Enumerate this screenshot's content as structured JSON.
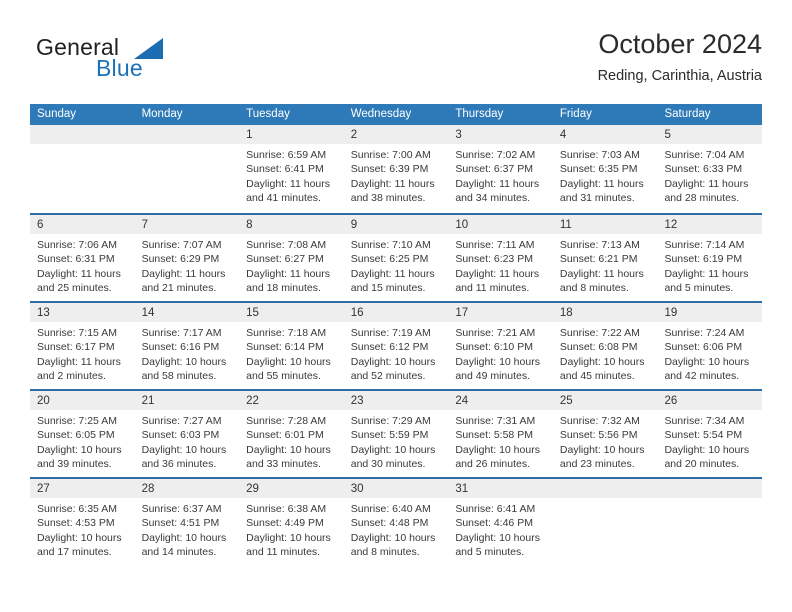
{
  "brand": {
    "name_part1": "General",
    "name_part2": "Blue",
    "accent_color": "#1b6cb0"
  },
  "header": {
    "title": "October 2024",
    "subtitle": "Reding, Carinthia, Austria"
  },
  "calendar": {
    "header_color": "#2e7ab8",
    "separator_color": "#2e6da4",
    "daynum_band_color": "#eeeeee",
    "weekdays": [
      "Sunday",
      "Monday",
      "Tuesday",
      "Wednesday",
      "Thursday",
      "Friday",
      "Saturday"
    ],
    "weeks": [
      [
        {
          "day": "",
          "sunrise": "",
          "sunset": "",
          "daylight_line1": "",
          "daylight_line2": ""
        },
        {
          "day": "",
          "sunrise": "",
          "sunset": "",
          "daylight_line1": "",
          "daylight_line2": ""
        },
        {
          "day": "1",
          "sunrise": "Sunrise: 6:59 AM",
          "sunset": "Sunset: 6:41 PM",
          "daylight_line1": "Daylight: 11 hours",
          "daylight_line2": "and 41 minutes."
        },
        {
          "day": "2",
          "sunrise": "Sunrise: 7:00 AM",
          "sunset": "Sunset: 6:39 PM",
          "daylight_line1": "Daylight: 11 hours",
          "daylight_line2": "and 38 minutes."
        },
        {
          "day": "3",
          "sunrise": "Sunrise: 7:02 AM",
          "sunset": "Sunset: 6:37 PM",
          "daylight_line1": "Daylight: 11 hours",
          "daylight_line2": "and 34 minutes."
        },
        {
          "day": "4",
          "sunrise": "Sunrise: 7:03 AM",
          "sunset": "Sunset: 6:35 PM",
          "daylight_line1": "Daylight: 11 hours",
          "daylight_line2": "and 31 minutes."
        },
        {
          "day": "5",
          "sunrise": "Sunrise: 7:04 AM",
          "sunset": "Sunset: 6:33 PM",
          "daylight_line1": "Daylight: 11 hours",
          "daylight_line2": "and 28 minutes."
        }
      ],
      [
        {
          "day": "6",
          "sunrise": "Sunrise: 7:06 AM",
          "sunset": "Sunset: 6:31 PM",
          "daylight_line1": "Daylight: 11 hours",
          "daylight_line2": "and 25 minutes."
        },
        {
          "day": "7",
          "sunrise": "Sunrise: 7:07 AM",
          "sunset": "Sunset: 6:29 PM",
          "daylight_line1": "Daylight: 11 hours",
          "daylight_line2": "and 21 minutes."
        },
        {
          "day": "8",
          "sunrise": "Sunrise: 7:08 AM",
          "sunset": "Sunset: 6:27 PM",
          "daylight_line1": "Daylight: 11 hours",
          "daylight_line2": "and 18 minutes."
        },
        {
          "day": "9",
          "sunrise": "Sunrise: 7:10 AM",
          "sunset": "Sunset: 6:25 PM",
          "daylight_line1": "Daylight: 11 hours",
          "daylight_line2": "and 15 minutes."
        },
        {
          "day": "10",
          "sunrise": "Sunrise: 7:11 AM",
          "sunset": "Sunset: 6:23 PM",
          "daylight_line1": "Daylight: 11 hours",
          "daylight_line2": "and 11 minutes."
        },
        {
          "day": "11",
          "sunrise": "Sunrise: 7:13 AM",
          "sunset": "Sunset: 6:21 PM",
          "daylight_line1": "Daylight: 11 hours",
          "daylight_line2": "and 8 minutes."
        },
        {
          "day": "12",
          "sunrise": "Sunrise: 7:14 AM",
          "sunset": "Sunset: 6:19 PM",
          "daylight_line1": "Daylight: 11 hours",
          "daylight_line2": "and 5 minutes."
        }
      ],
      [
        {
          "day": "13",
          "sunrise": "Sunrise: 7:15 AM",
          "sunset": "Sunset: 6:17 PM",
          "daylight_line1": "Daylight: 11 hours",
          "daylight_line2": "and 2 minutes."
        },
        {
          "day": "14",
          "sunrise": "Sunrise: 7:17 AM",
          "sunset": "Sunset: 6:16 PM",
          "daylight_line1": "Daylight: 10 hours",
          "daylight_line2": "and 58 minutes."
        },
        {
          "day": "15",
          "sunrise": "Sunrise: 7:18 AM",
          "sunset": "Sunset: 6:14 PM",
          "daylight_line1": "Daylight: 10 hours",
          "daylight_line2": "and 55 minutes."
        },
        {
          "day": "16",
          "sunrise": "Sunrise: 7:19 AM",
          "sunset": "Sunset: 6:12 PM",
          "daylight_line1": "Daylight: 10 hours",
          "daylight_line2": "and 52 minutes."
        },
        {
          "day": "17",
          "sunrise": "Sunrise: 7:21 AM",
          "sunset": "Sunset: 6:10 PM",
          "daylight_line1": "Daylight: 10 hours",
          "daylight_line2": "and 49 minutes."
        },
        {
          "day": "18",
          "sunrise": "Sunrise: 7:22 AM",
          "sunset": "Sunset: 6:08 PM",
          "daylight_line1": "Daylight: 10 hours",
          "daylight_line2": "and 45 minutes."
        },
        {
          "day": "19",
          "sunrise": "Sunrise: 7:24 AM",
          "sunset": "Sunset: 6:06 PM",
          "daylight_line1": "Daylight: 10 hours",
          "daylight_line2": "and 42 minutes."
        }
      ],
      [
        {
          "day": "20",
          "sunrise": "Sunrise: 7:25 AM",
          "sunset": "Sunset: 6:05 PM",
          "daylight_line1": "Daylight: 10 hours",
          "daylight_line2": "and 39 minutes."
        },
        {
          "day": "21",
          "sunrise": "Sunrise: 7:27 AM",
          "sunset": "Sunset: 6:03 PM",
          "daylight_line1": "Daylight: 10 hours",
          "daylight_line2": "and 36 minutes."
        },
        {
          "day": "22",
          "sunrise": "Sunrise: 7:28 AM",
          "sunset": "Sunset: 6:01 PM",
          "daylight_line1": "Daylight: 10 hours",
          "daylight_line2": "and 33 minutes."
        },
        {
          "day": "23",
          "sunrise": "Sunrise: 7:29 AM",
          "sunset": "Sunset: 5:59 PM",
          "daylight_line1": "Daylight: 10 hours",
          "daylight_line2": "and 30 minutes."
        },
        {
          "day": "24",
          "sunrise": "Sunrise: 7:31 AM",
          "sunset": "Sunset: 5:58 PM",
          "daylight_line1": "Daylight: 10 hours",
          "daylight_line2": "and 26 minutes."
        },
        {
          "day": "25",
          "sunrise": "Sunrise: 7:32 AM",
          "sunset": "Sunset: 5:56 PM",
          "daylight_line1": "Daylight: 10 hours",
          "daylight_line2": "and 23 minutes."
        },
        {
          "day": "26",
          "sunrise": "Sunrise: 7:34 AM",
          "sunset": "Sunset: 5:54 PM",
          "daylight_line1": "Daylight: 10 hours",
          "daylight_line2": "and 20 minutes."
        }
      ],
      [
        {
          "day": "27",
          "sunrise": "Sunrise: 6:35 AM",
          "sunset": "Sunset: 4:53 PM",
          "daylight_line1": "Daylight: 10 hours",
          "daylight_line2": "and 17 minutes."
        },
        {
          "day": "28",
          "sunrise": "Sunrise: 6:37 AM",
          "sunset": "Sunset: 4:51 PM",
          "daylight_line1": "Daylight: 10 hours",
          "daylight_line2": "and 14 minutes."
        },
        {
          "day": "29",
          "sunrise": "Sunrise: 6:38 AM",
          "sunset": "Sunset: 4:49 PM",
          "daylight_line1": "Daylight: 10 hours",
          "daylight_line2": "and 11 minutes."
        },
        {
          "day": "30",
          "sunrise": "Sunrise: 6:40 AM",
          "sunset": "Sunset: 4:48 PM",
          "daylight_line1": "Daylight: 10 hours",
          "daylight_line2": "and 8 minutes."
        },
        {
          "day": "31",
          "sunrise": "Sunrise: 6:41 AM",
          "sunset": "Sunset: 4:46 PM",
          "daylight_line1": "Daylight: 10 hours",
          "daylight_line2": "and 5 minutes."
        },
        {
          "day": "",
          "sunrise": "",
          "sunset": "",
          "daylight_line1": "",
          "daylight_line2": ""
        },
        {
          "day": "",
          "sunrise": "",
          "sunset": "",
          "daylight_line1": "",
          "daylight_line2": ""
        }
      ]
    ]
  }
}
